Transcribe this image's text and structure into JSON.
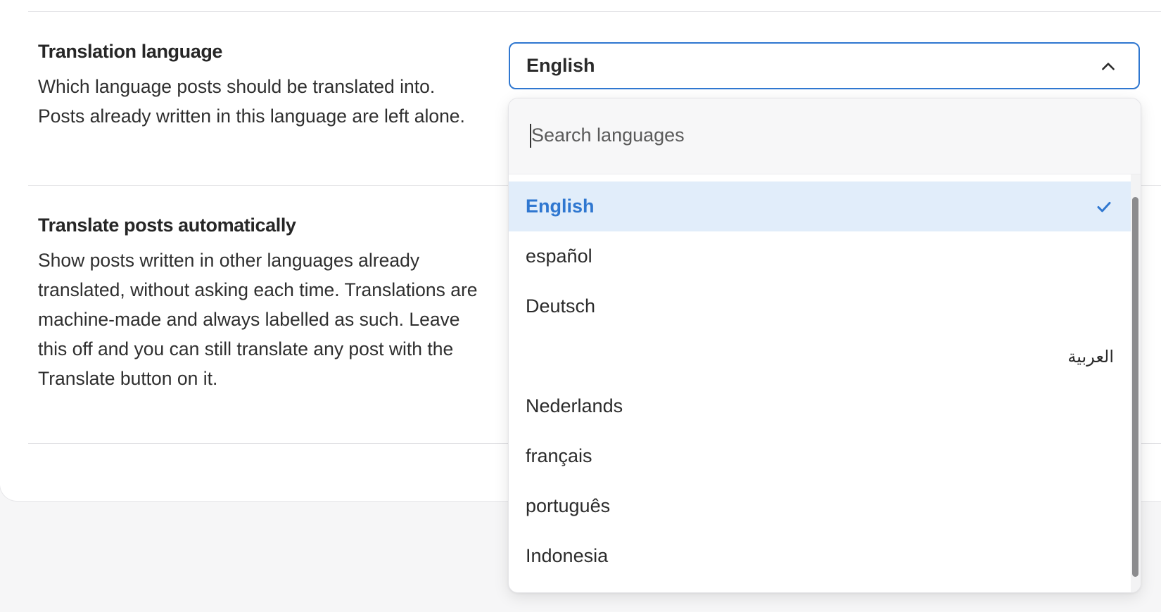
{
  "settings": {
    "translation_language": {
      "title": "Translation language",
      "description": "Which language posts should be translated into. Posts already written in this language are left alone."
    },
    "auto_translate": {
      "title": "Translate posts automatically",
      "description": "Show posts written in other languages already translated, without asking each time. Translations are machine-made and always labelled as such. Leave this off and you can still translate any post with the Translate button on it."
    }
  },
  "language_select": {
    "value": "English",
    "expanded": true,
    "search_placeholder": "Search languages",
    "search_value": "",
    "options": [
      {
        "label": "English",
        "selected": true
      },
      {
        "label": "español",
        "selected": false
      },
      {
        "label": "Deutsch",
        "selected": false
      },
      {
        "label": "العربية",
        "selected": false,
        "rtl": true
      },
      {
        "label": "Nederlands",
        "selected": false
      },
      {
        "label": "français",
        "selected": false
      },
      {
        "label": "português",
        "selected": false
      },
      {
        "label": "Indonesia",
        "selected": false
      }
    ]
  },
  "icons": {
    "trigger": "chevron-up-icon",
    "selected": "checkmark-icon"
  },
  "colors": {
    "accent": "#2f77d0",
    "selected_bg": "#e1edfa",
    "text": "#2b2b2b",
    "page_bg": "#f6f6f7"
  }
}
